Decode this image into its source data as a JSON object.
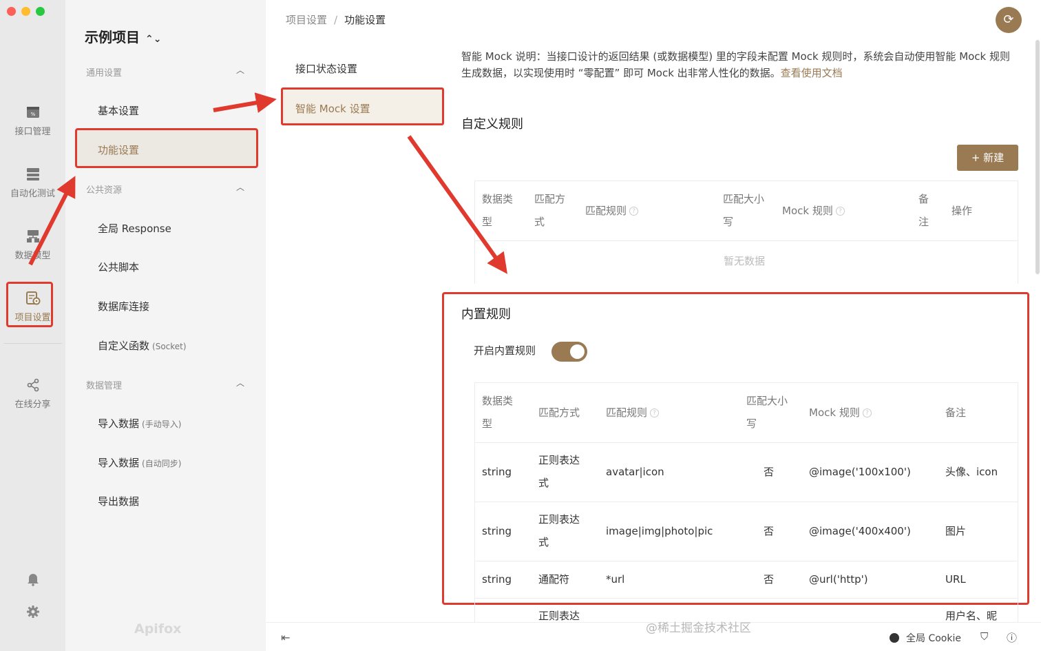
{
  "window": {
    "traffic_colors": [
      "#fe5f57",
      "#febc2e",
      "#28c840"
    ]
  },
  "rail": {
    "items": [
      {
        "label": "接口管理",
        "icon": "api-icon"
      },
      {
        "label": "自动化测试",
        "icon": "automation-icon"
      },
      {
        "label": "数据模型",
        "icon": "data-model-icon"
      },
      {
        "label": "项目设置",
        "icon": "project-settings-icon",
        "active": true
      },
      {
        "label": "在线分享",
        "icon": "share-icon"
      }
    ]
  },
  "sidebar": {
    "project_name": "示例项目",
    "groups": [
      {
        "title": "通用设置",
        "items": [
          "基本设置",
          "功能设置"
        ]
      },
      {
        "title": "公共资源",
        "items": [
          "全局 Response",
          "公共脚本",
          "数据库连接",
          "自定义函数"
        ]
      },
      {
        "title": "数据管理",
        "items": [
          "导入数据",
          "导入数据",
          "导出数据"
        ]
      }
    ],
    "item_subs": {
      "custom_func": "(Socket)",
      "import_manual": "(手动导入)",
      "import_auto": "(自动同步)"
    },
    "brand": "Apifox"
  },
  "breadcrumb": {
    "parent": "项目设置",
    "sep": "/",
    "current": "功能设置"
  },
  "inner_nav": {
    "items": [
      "接口状态设置",
      "智能 Mock 设置"
    ],
    "active_index": 1
  },
  "description": {
    "text": "智能 Mock 说明：当接口设计的返回结果 (或数据模型) 里的字段未配置 Mock 规则时，系统会自动使用智能 Mock 规则生成数据，以实现使用时 “零配置” 即可 Mock 出非常人性化的数据。",
    "link": "查看使用文档"
  },
  "custom_rules": {
    "title": "自定义规则",
    "new_button": "+ 新建",
    "columns": [
      "数据类型",
      "匹配方式",
      "匹配规则",
      "匹配大小写",
      "Mock 规则",
      "备注",
      "操作"
    ],
    "empty_text": "暂无数据"
  },
  "builtin_rules": {
    "title": "内置规则",
    "toggle_label": "开启内置规则",
    "toggle_on": true,
    "columns": [
      "数据类型",
      "匹配方式",
      "匹配规则",
      "匹配大小写",
      "Mock 规则",
      "备注"
    ],
    "rows": [
      {
        "type": "string",
        "method": "正则表达式",
        "rule": "avatar|icon",
        "case": "否",
        "mock": "@image('100x100')",
        "note": "头像、icon"
      },
      {
        "type": "string",
        "method": "正则表达式",
        "rule": "image|img|photo|pic",
        "case": "否",
        "mock": "@image('400x400')",
        "note": "图片"
      },
      {
        "type": "string",
        "method": "通配符",
        "rule": "*url",
        "case": "否",
        "mock": "@url('http')",
        "note": "URL"
      },
      {
        "type": "",
        "method": "正则表达",
        "rule": "",
        "case": "",
        "mock": "",
        "note": "用户名、昵"
      }
    ]
  },
  "bottom_bar": {
    "cookie_label": "全局 Cookie"
  },
  "watermark": "@稀土掘金技术社区",
  "colors": {
    "accent": "#9a7a52",
    "highlight": "#e03a2f"
  }
}
